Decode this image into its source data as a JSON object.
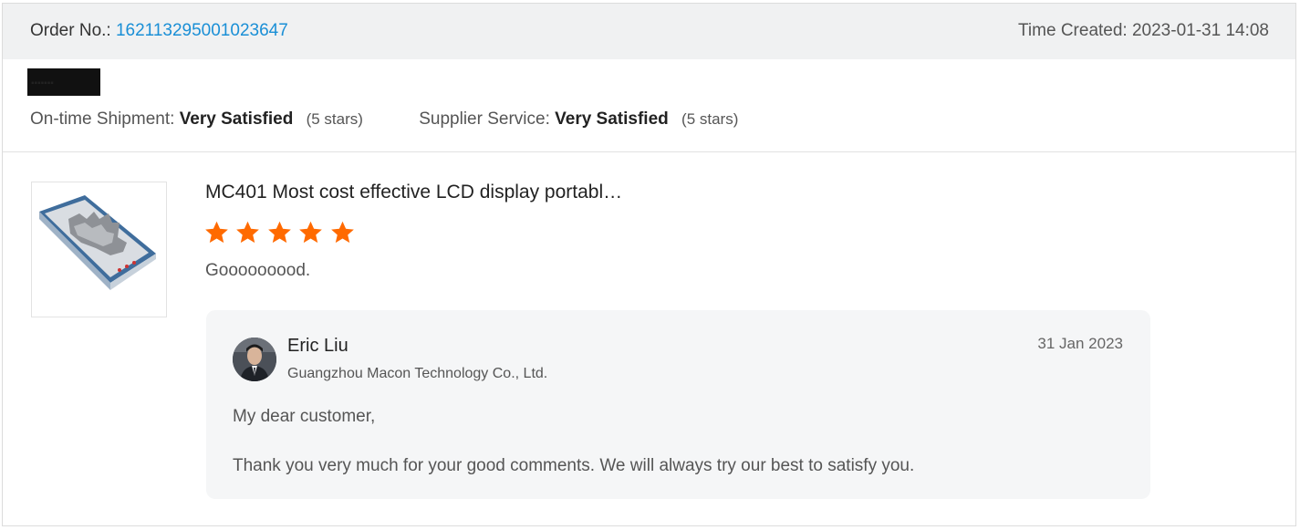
{
  "order": {
    "number_label": "Order No.:",
    "number": "162113295001023647",
    "time_label": "Time Created:",
    "time_value": "2023-01-31 14:08"
  },
  "ratings": [
    {
      "label": "On-time Shipment:",
      "value": "Very Satisfied",
      "stars": "(5 stars)"
    },
    {
      "label": "Supplier Service:",
      "value": "Very Satisfied",
      "stars": "(5 stars)"
    }
  ],
  "review": {
    "product_title": "MC401 Most cost effective LCD display portabl…",
    "star_rating": 5,
    "star_color": "#ff6a00",
    "text": "Gooooooood."
  },
  "reply": {
    "name": "Eric Liu",
    "company": "Guangzhou Macon Technology Co., Ltd.",
    "date": "31 Jan 2023",
    "greeting": "My dear customer,",
    "body": "Thank you very much for your good comments. We will always try our best to satisfy you."
  },
  "colors": {
    "link": "#1a8fd6",
    "header_bg": "#f0f1f2",
    "reply_bg": "#f5f6f7"
  }
}
